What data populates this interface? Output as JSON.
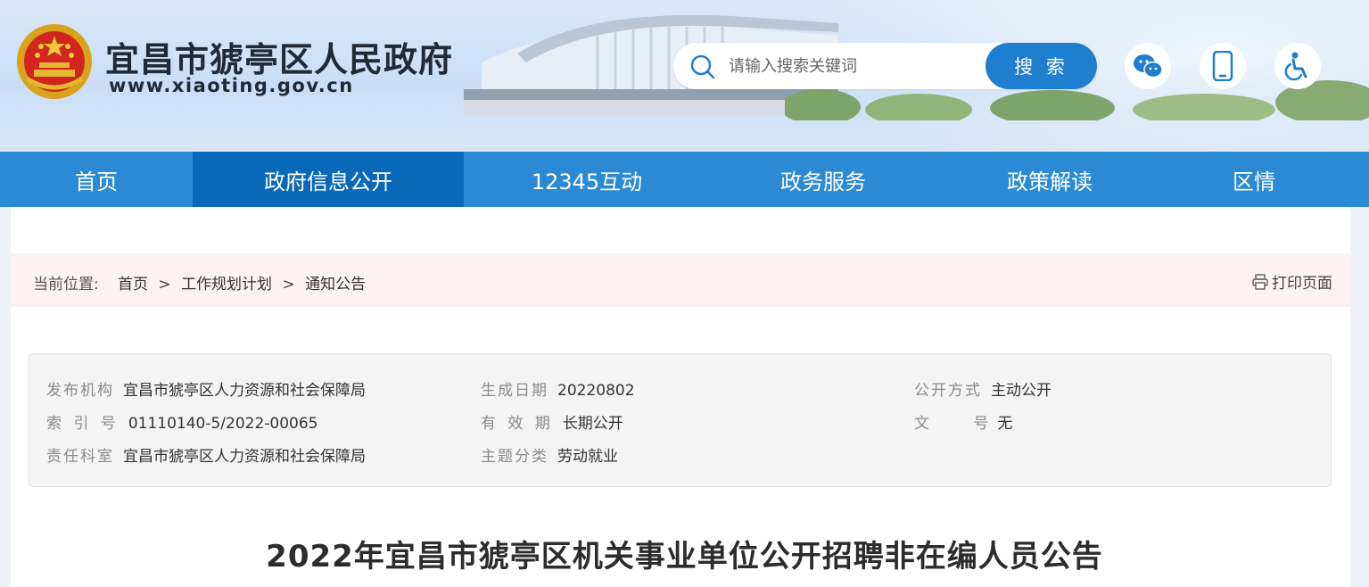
{
  "header": {
    "site_title": "宜昌市猇亭区人民政府",
    "site_domain": "www.xiaoting.gov.cn",
    "search": {
      "placeholder": "请输入搜索关键词",
      "button_label": "搜 索"
    },
    "icons": [
      "wechat-icon",
      "mobile-icon",
      "accessibility-icon"
    ],
    "brand_color": "#2b8ad3",
    "search_button_color": "#1f7fce"
  },
  "nav": {
    "items": [
      {
        "label": "首页"
      },
      {
        "label": "政府信息公开"
      },
      {
        "label": "12345互动"
      },
      {
        "label": "政务服务"
      },
      {
        "label": "政策解读"
      },
      {
        "label": "区情"
      }
    ],
    "active_index": 1,
    "active_color": "#0a68b8"
  },
  "breadcrumb": {
    "label": "当前位置:",
    "items": [
      "首页",
      "工作规划计划",
      "通知公告"
    ],
    "separator": ">",
    "print_label": "打印页面"
  },
  "meta": {
    "rows": [
      [
        {
          "key": "发布机构",
          "value": "宜昌市猇亭区人力资源和社会保障局"
        },
        {
          "key": "生成日期",
          "value": "20220802"
        },
        {
          "key": "公开方式",
          "value": "主动公开"
        }
      ],
      [
        {
          "key": "索 引 号",
          "value": "01110140-5/2022-00065"
        },
        {
          "key": "有 效 期",
          "value": "长期公开"
        },
        {
          "key": "文 号",
          "value": "无"
        }
      ],
      [
        {
          "key": "责任科室",
          "value": "宜昌市猇亭区人力资源和社会保障局"
        },
        {
          "key": "主题分类",
          "value": "劳动就业"
        }
      ]
    ]
  },
  "article": {
    "title": "2022年宜昌市猇亭区机关事业单位公开招聘非在编人员公告"
  }
}
